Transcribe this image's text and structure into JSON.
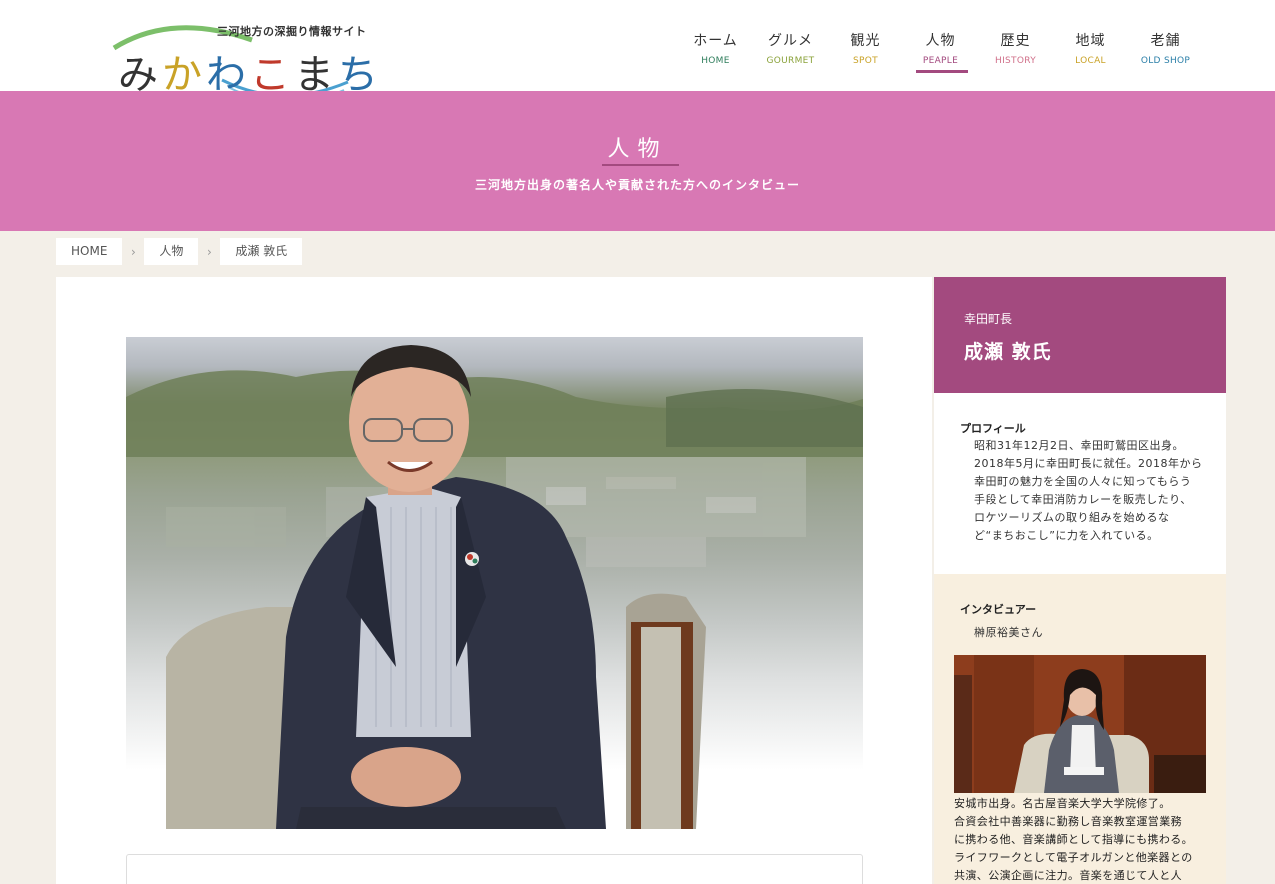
{
  "header": {
    "tagline": "三河地方の深掘り情報サイト",
    "logo_chars": [
      {
        "ch": "み",
        "color": "#333333"
      },
      {
        "ch": "か",
        "color": "#c9a227"
      },
      {
        "ch": "わ",
        "color": "#2b6ea8"
      },
      {
        "ch": "こ",
        "color": "#c0392b"
      },
      {
        "ch": "ま",
        "color": "#333333"
      },
      {
        "ch": "ち",
        "color": "#2b6ea8"
      }
    ],
    "nav": [
      {
        "jp": "ホーム",
        "en": "HOME",
        "color": "#2e7d5b",
        "active": false
      },
      {
        "jp": "グルメ",
        "en": "GOURMET",
        "color": "#8aa23a",
        "active": false
      },
      {
        "jp": "観光",
        "en": "SPOT",
        "color": "#c9a227",
        "active": false
      },
      {
        "jp": "人物",
        "en": "PEAPLE",
        "color": "#a34a7f",
        "active": true
      },
      {
        "jp": "歴史",
        "en": "HISTORY",
        "color": "#d0708a",
        "active": false
      },
      {
        "jp": "地域",
        "en": "LOCAL",
        "color": "#c9a227",
        "active": false
      },
      {
        "jp": "老舗",
        "en": "OLD SHOP",
        "color": "#2b7fa8",
        "active": false
      }
    ]
  },
  "hero": {
    "title": "人物",
    "subtitle": "三河地方出身の著名人や貢献された方へのインタビュー",
    "bg_color": "#d878b4"
  },
  "breadcrumb": {
    "items": [
      "HOME",
      "人物",
      "成瀬 敦氏"
    ],
    "separator": "›"
  },
  "sidebar": {
    "role": "幸田町長",
    "name": "成瀬 敦氏",
    "profile_label": "プロフィール",
    "profile_lines": [
      "昭和31年12月2日、幸田町鷲田区出身。",
      "2018年5月に幸田町長に就任。2018年から",
      "幸田町の魅力を全国の人々に知ってもらう",
      "手段として幸田消防カレーを販売したり、",
      "ロケツーリズムの取り組みを始めるな",
      "ど“まちおこし”に力を入れている。"
    ],
    "interviewer_label": "インタビュアー",
    "interviewer_name": "榊原裕美さん",
    "interviewer_lines": [
      "安城市出身。名古屋音楽大学大学院修了。",
      "合資会社中善楽器に勤務し音楽教室運営業務",
      "に携わる他、音楽講師として指導にも携わる。",
      "ライフワークとして電子オルガンと他楽器との",
      "共演、公演企画に注力。音楽を通じて人と人"
    ],
    "accent_color": "#a34a7f"
  }
}
